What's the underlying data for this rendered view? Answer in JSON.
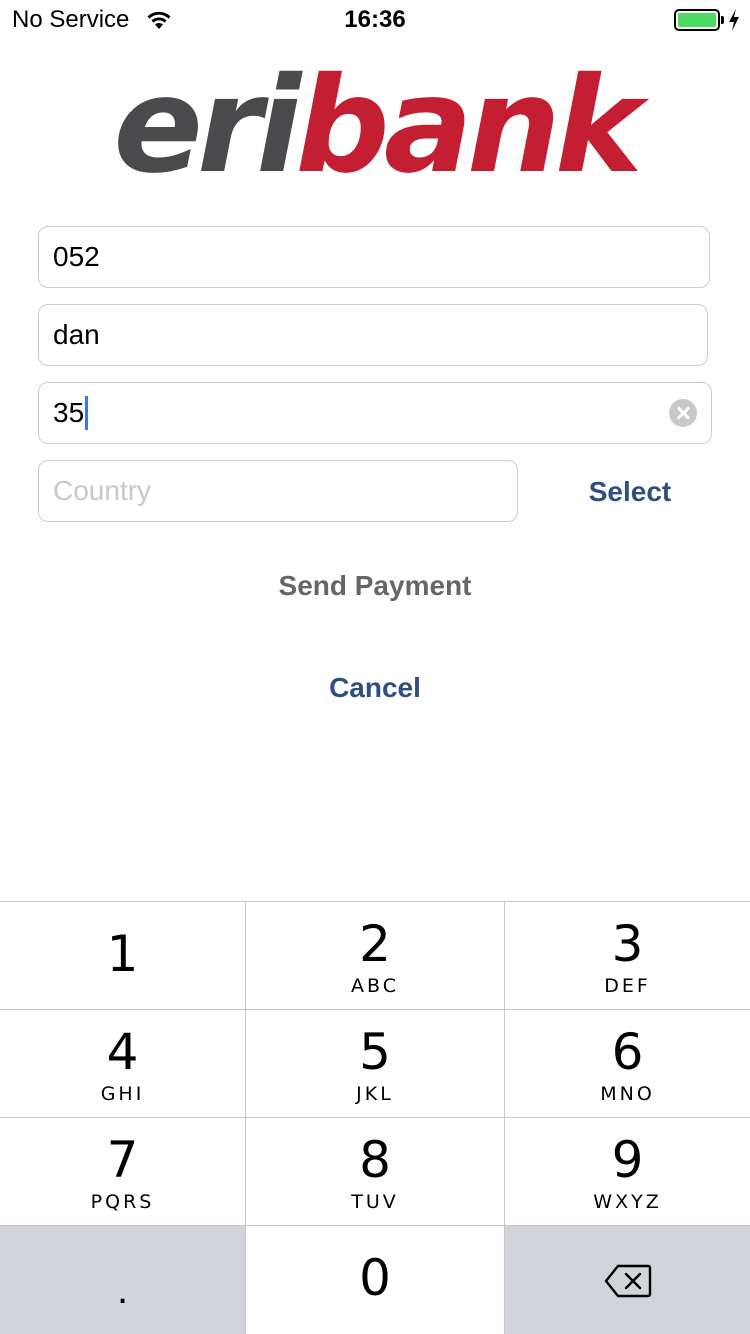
{
  "status_bar": {
    "carrier": "No Service",
    "time": "16:36",
    "battery_level": 1.0,
    "battery_color": "#4cd964",
    "charging": true
  },
  "logo": {
    "part1": "eri",
    "part2": "bank",
    "color1": "#4a4a4c",
    "color2": "#c41e32"
  },
  "form": {
    "field1_value": "052",
    "field2_value": "dan",
    "field3_value": "35",
    "country_placeholder": "Country",
    "select_label": "Select",
    "send_label": "Send Payment",
    "cancel_label": "Cancel"
  },
  "keypad": {
    "keys": [
      {
        "num": "1",
        "letters": ""
      },
      {
        "num": "2",
        "letters": "ABC"
      },
      {
        "num": "3",
        "letters": "DEF"
      },
      {
        "num": "4",
        "letters": "GHI"
      },
      {
        "num": "5",
        "letters": "JKL"
      },
      {
        "num": "6",
        "letters": "MNO"
      },
      {
        "num": "7",
        "letters": "PQRS"
      },
      {
        "num": "8",
        "letters": "TUV"
      },
      {
        "num": "9",
        "letters": "WXYZ"
      },
      {
        "num": ".",
        "letters": ""
      },
      {
        "num": "0",
        "letters": ""
      }
    ],
    "backspace_icon": "backspace-icon"
  },
  "colors": {
    "accent": "#2f4f80",
    "caret": "#3478f6"
  }
}
